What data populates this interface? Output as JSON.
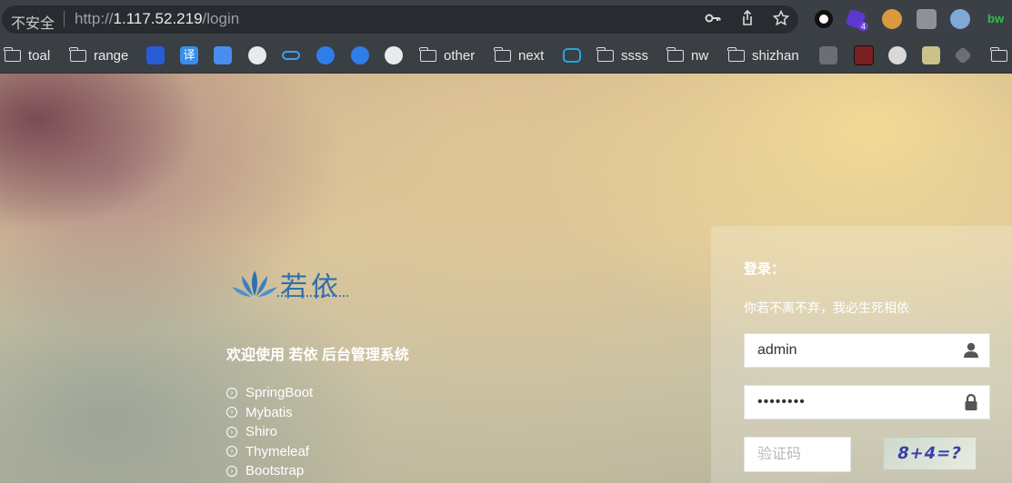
{
  "address_bar": {
    "security_label": "不安全",
    "url_prefix": "http://",
    "url_host": "1.117.52.219",
    "url_path": "/login",
    "extension_badge": "4"
  },
  "bookmarks": [
    {
      "label": "toal",
      "icon": "folder-icon"
    },
    {
      "label": "range",
      "icon": "folder-icon"
    },
    {
      "label": "",
      "icon": "baidu-icon"
    },
    {
      "label": "",
      "icon": "translate-icon"
    },
    {
      "label": "",
      "icon": "google-translate-icon"
    },
    {
      "label": "",
      "icon": "github-icon"
    },
    {
      "label": "",
      "icon": "cloud-icon"
    },
    {
      "label": "",
      "icon": "f-icon"
    },
    {
      "label": "",
      "icon": "f-icon"
    },
    {
      "label": "",
      "icon": "globe-icon"
    },
    {
      "label": "other",
      "icon": "folder-icon"
    },
    {
      "label": "next",
      "icon": "folder-icon"
    },
    {
      "label": "",
      "icon": "bilibili-icon"
    },
    {
      "label": "ssss",
      "icon": "folder-icon"
    },
    {
      "label": "nw",
      "icon": "folder-icon"
    },
    {
      "label": "shizhan",
      "icon": "folder-icon"
    },
    {
      "label": "",
      "icon": "folder-icon"
    }
  ],
  "page": {
    "logo_text": "若依",
    "welcome": "欢迎使用 若依 后台管理系统",
    "features": [
      "SpringBoot",
      "Mybatis",
      "Shiro",
      "Thymeleaf",
      "Bootstrap"
    ]
  },
  "login": {
    "title": "登录：",
    "subtitle": "你若不离不弃，我必生死相依",
    "username_value": "admin",
    "password_value": "••••••••",
    "captcha_placeholder": "验证码",
    "captcha_text": "8+4=?"
  },
  "colors": {
    "logo_blue": "#2f6fae",
    "captcha_text": "#3a3fa8",
    "toolbar_bg": "#3b4046"
  }
}
